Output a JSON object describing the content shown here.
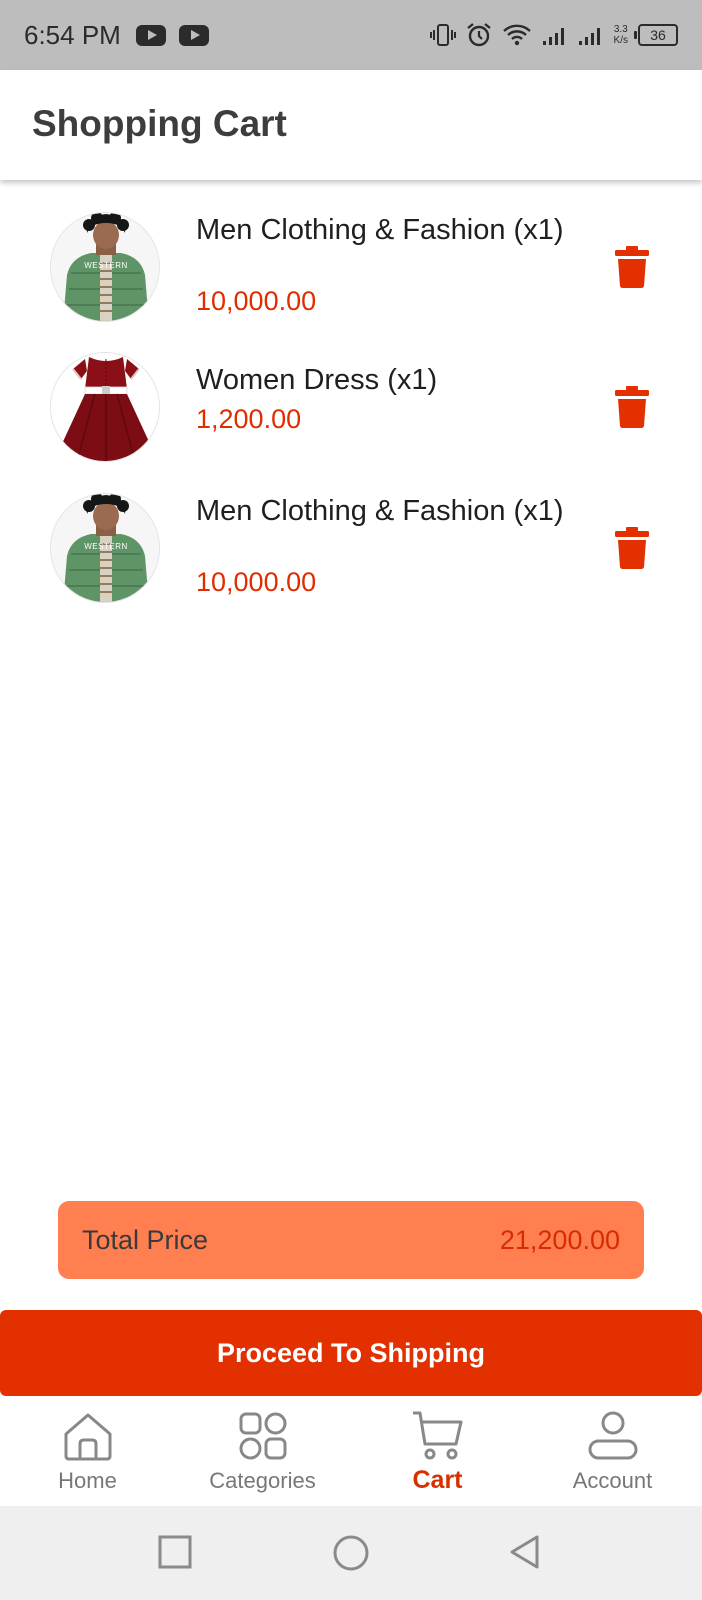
{
  "status_bar": {
    "time": "6:54 PM",
    "icons": [
      "youtube-icon",
      "youtube-icon",
      "vibrate-icon",
      "alarm-icon",
      "wifi-icon",
      "signal-icon",
      "signal-icon"
    ],
    "net_speed_value": "3.3",
    "net_speed_unit": "K/s",
    "battery": "36"
  },
  "header": {
    "title": "Shopping Cart"
  },
  "cart": {
    "items": [
      {
        "name": "Men Clothing & Fashion (x1)",
        "price": "10,000.00",
        "image_text": "WESTERN",
        "image": "jacket"
      },
      {
        "name": "Women Dress (x1)",
        "price": "1,200.00",
        "image": "dress"
      },
      {
        "name": "Men Clothing & Fashion (x1)",
        "price": "10,000.00",
        "image_text": "WESTERN",
        "image": "jacket"
      }
    ],
    "delete_icon": "trash-icon"
  },
  "total": {
    "label": "Total Price",
    "value": "21,200.00"
  },
  "proceed_label": "Proceed To Shipping",
  "nav": {
    "items": [
      {
        "label": "Home",
        "icon": "home-icon",
        "active": false
      },
      {
        "label": "Categories",
        "icon": "grid-icon",
        "active": false
      },
      {
        "label": "Cart",
        "icon": "cart-icon",
        "active": true
      },
      {
        "label": "Account",
        "icon": "user-icon",
        "active": false
      }
    ]
  },
  "system_nav": [
    "recents-icon",
    "home-circle-icon",
    "back-icon"
  ],
  "colors": {
    "accent": "#e33000",
    "price": "#e02d00",
    "total_bg": "#ff7f50",
    "status_bar": "#bdbdbd"
  }
}
